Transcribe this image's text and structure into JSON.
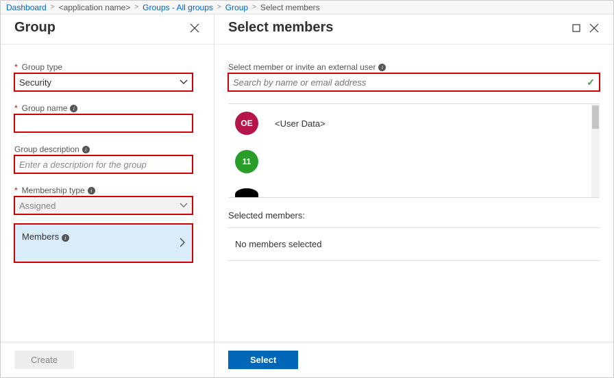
{
  "breadcrumb": {
    "dashboard": "Dashboard",
    "app": "<application name>",
    "groups": "Groups - All groups",
    "group": "Group",
    "current": "Select members"
  },
  "leftPanel": {
    "title": "Group",
    "groupTypeLabel": "Group type",
    "groupTypeValue": "Security",
    "groupNameLabel": "Group name",
    "groupNameValue": "",
    "groupDescLabel": "Group description",
    "groupDescPlaceholder": "Enter a description for the group",
    "membershipTypeLabel": "Membership type",
    "membershipTypeValue": "Assigned",
    "membersLabel": "Members",
    "createLabel": "Create"
  },
  "rightPanel": {
    "title": "Select members",
    "searchLabel": "Select member or invite an external user",
    "searchPlaceholder": "Search by name or email address",
    "users": [
      {
        "initials": "OE",
        "name": "<User Data>",
        "color": "crimson"
      },
      {
        "initials": "11",
        "name": "",
        "color": "green"
      }
    ],
    "selectedLabel": "Selected members:",
    "noMembers": "No members selected",
    "selectLabel": "Select"
  }
}
